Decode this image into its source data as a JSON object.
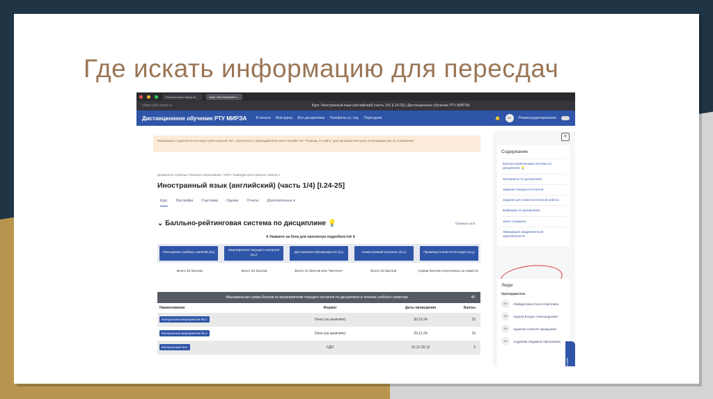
{
  "slide": {
    "title": "Где искать информацию для пересдач"
  },
  "browser": {
    "tabs": [
      "Консультация перед пе...",
      "Курс: Иностранный я..."
    ],
    "url": "online-edu.mirea.ru",
    "page_title": "Курс: Иностранный язык (английский) (часть 1/4) [I.24-25] | Дистанционное обучение РТУ МИРЭА"
  },
  "nav": {
    "logo": "Дистанционное обучение РТУ МИРЭА",
    "links": [
      "В начало",
      "Мои курсы",
      "Все дисциплины",
      "Телефоны уч. отд.",
      "Пересдачи"
    ],
    "avatar": "ВИ",
    "edit_mode": "Режим редактирования"
  },
  "notice": "Уважаемые студенты! Если недоступен нужный тест, обратитесь к преподавателю или в онлайн-чат \"Помощь по сайту\" для проверки настроек. Благодарим вас за понимание!",
  "breadcrumb": "Домашняя страница / Высшее образование / ИРИ / Кафедра иностранных языков 1",
  "course_title": "Иностранный язык (английский) (часть 1/4) [I.24-25]",
  "course_tabs": [
    "Курс",
    "Настройки",
    "Участники",
    "Оценки",
    "Отчеты",
    "Дополнительно ▾"
  ],
  "section": {
    "title": "Балльно-рейтинговая система по дисциплине 💡",
    "collapse_all": "Свернуть всё",
    "hint": "⬇ Нажмите на блок для просмотра подробностей ⬇"
  },
  "blocks": [
    {
      "label": "Посещение учебных занятий (Sₑ)",
      "total": "Всего 30 баллов"
    },
    {
      "label": "Мероприятия текущего контроля (Sₜₖ)",
      "total": "Всего 40 баллов"
    },
    {
      "label": "Достижения обучающегося (Sₒ)",
      "total": "Всего 10 баллов или \"Зачтено\""
    },
    {
      "label": "Семестровый контроль (Sₛₖ)",
      "total": "Всего 20 баллов"
    },
    {
      "label": "Промежуточная аттестация (Sₚₐ)",
      "total": "Сумма баллов полученных за семестр"
    }
  ],
  "table": {
    "header": "Максимальная сумма баллов по мероприятиям текущего контроля по дисциплине в течение учебного семестра",
    "header_value": "40",
    "columns": [
      "Наименование",
      "Формат",
      "Даты проведения",
      "Баллы"
    ],
    "rows": [
      {
        "name": "Контрольное мероприятие № 1",
        "format": "Очно (на занятиях)",
        "dates": "30.10.24",
        "points": "15"
      },
      {
        "name": "Контрольное мероприятие № 2",
        "format": "Очно (на занятиях)",
        "dates": "20.12.24",
        "points": "15"
      },
      {
        "name": "Контрольный тест",
        "format": "СДО",
        "dates": "15.12-20.12",
        "points": "5"
      }
    ]
  },
  "sidebar": {
    "close": "×",
    "contents_title": "Содержание",
    "items": [
      "Балльно-рейтинговая система по дисциплине 💡",
      "Материалы по дисциплине",
      "Задания текущего контроля",
      "Задания для самостоятельной работы",
      "Вебинары по дисциплине",
      "Зачет (экзамен)",
      "Ликвидация академической задолженности"
    ],
    "people_title": "Люди",
    "role": "Преподаватель",
    "people": [
      {
        "initials": "АО",
        "name": "Абайдуллина Ольга Сергеевна"
      },
      {
        "initials": "АБ",
        "name": "Авдеев Богдан Александрович"
      },
      {
        "initials": "АА",
        "name": "Адьянов Алексей Аркадьевич"
      },
      {
        "initials": "АЛ",
        "name": "Андреева Людмила Николаевна"
      }
    ],
    "help": "Мы сейчас онлайн"
  }
}
